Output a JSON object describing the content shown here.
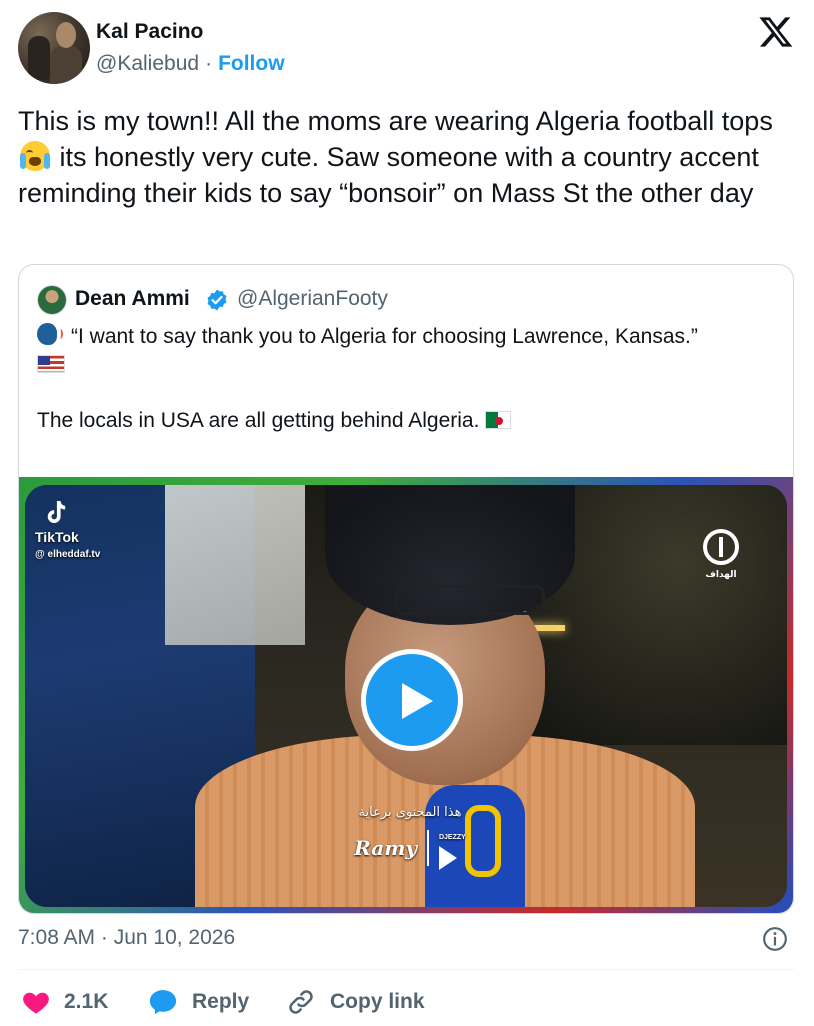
{
  "author": {
    "name": "Kal Pacino",
    "handle": "@Kaliebud",
    "separator": "·",
    "follow_label": "Follow"
  },
  "tweet": {
    "text_part1": "This is my town!! All the moms are wearing Algeria football tops",
    "text_part2": "its honestly very cute. Saw someone with a country accent reminding their kids to say “bonsoir” on Mass St the other day",
    "emoji_icon": "loudly-crying-face-icon"
  },
  "quote": {
    "author_name": "Dean Ammi",
    "author_handle": "@AlgerianFooty",
    "verified_color": "#1d9bf0",
    "line1": "“I want to say thank you to Algeria for choosing Lawrence, Kansas.”",
    "line3": "The locals in USA are all getting behind Algeria.",
    "icons": [
      "speaking-head-icon",
      "us-flag-icon",
      "algeria-flag-icon"
    ]
  },
  "video": {
    "tiktok_label": "TikTok",
    "tiktok_user": "@ elheddaf.tv",
    "channel_logo_text": "الهداف",
    "sponsor_arabic": "هذا المحتوى برعاية",
    "sponsor_brand": "Ramy",
    "sponsor_brand2": "DJEZZY",
    "play_color": "#1d9bf0"
  },
  "meta": {
    "timestamp": "7:08 AM · Jun 10, 2026"
  },
  "actions": {
    "like_count": "2.1K",
    "reply_label": "Reply",
    "copy_label": "Copy link",
    "like_color": "#f91880",
    "reply_color": "#1d9bf0"
  }
}
